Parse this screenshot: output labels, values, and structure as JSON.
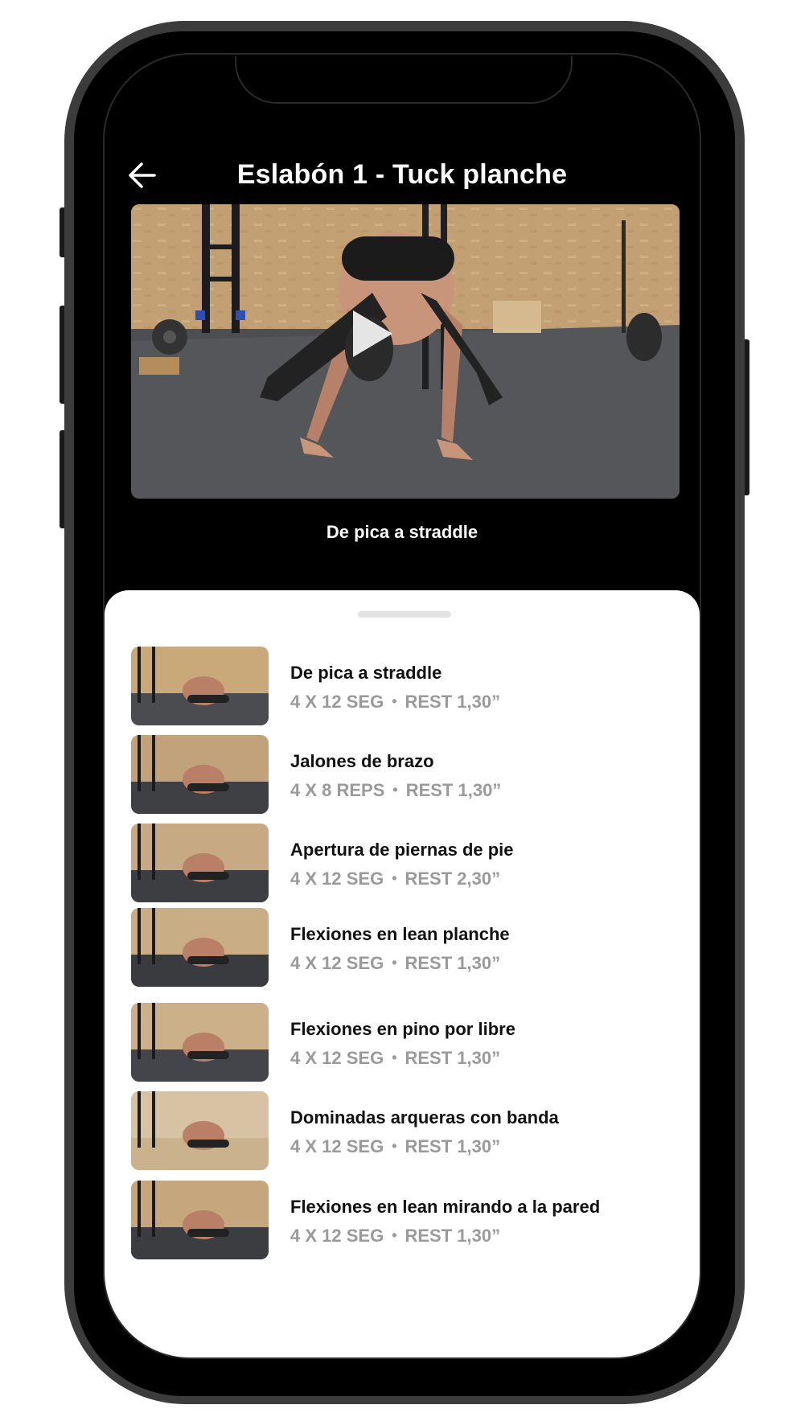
{
  "header": {
    "title": "Eslabón 1 - Tuck planche"
  },
  "video": {
    "caption": "De pica a straddle"
  },
  "exercises": [
    {
      "title": "De pica a straddle",
      "sets": "4 X 12 SEG",
      "rest": "REST 1,30”"
    },
    {
      "title": "Jalones de brazo",
      "sets": "4 X 8 REPS",
      "rest": "REST 1,30”"
    },
    {
      "title": "Apertura de piernas de pie",
      "sets": "4 X 12 SEG",
      "rest": "REST 2,30”"
    },
    {
      "title": "Flexiones en lean planche",
      "sets": "4 X 12 SEG",
      "rest": "REST 1,30”"
    },
    {
      "title": "Flexiones en pino por libre",
      "sets": "4 X 12 SEG",
      "rest": "REST 1,30”"
    },
    {
      "title": "Dominadas arqueras con banda",
      "sets": "4 X 12 SEG",
      "rest": "REST 1,30”"
    },
    {
      "title": "Flexiones en lean mirando a la pared",
      "sets": "4 X 12 SEG",
      "rest": "REST 1,30”"
    }
  ],
  "separator": "•",
  "icons": {
    "back": "arrow-left-icon",
    "play": "play-icon"
  }
}
